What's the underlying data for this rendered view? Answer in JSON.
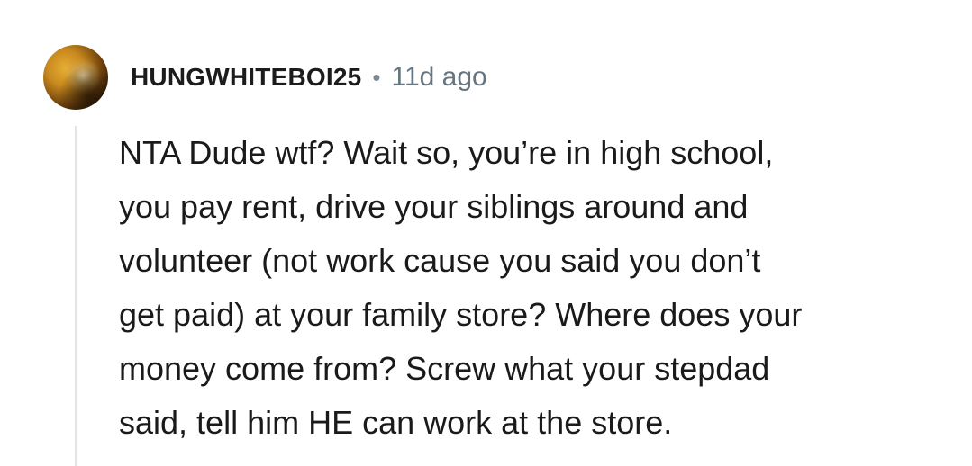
{
  "comment": {
    "author": "HUNGWHITEBOI25",
    "separator": "•",
    "timestamp": "11d ago",
    "body": "NTA Dude wtf? Wait so, you’re in high school,\nyou pay rent, drive your siblings around and\nvolunteer (not work cause you said you don’t\nget paid) at your family store? Where does your\nmoney come from? Screw what your stepdad\nsaid, tell him HE can work at the store."
  },
  "colors": {
    "username": "#1c1c1c",
    "meta": "#66757f",
    "thread_line": "#e4e4e4"
  },
  "icons": {
    "avatar": "user-avatar"
  }
}
